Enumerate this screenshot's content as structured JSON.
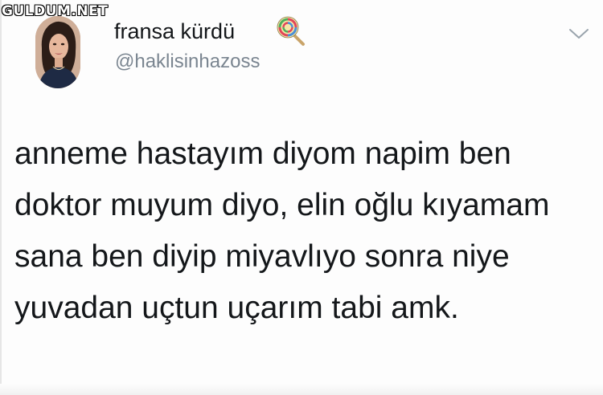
{
  "watermark": {
    "text": "GULDUM.NET"
  },
  "tweet": {
    "author": {
      "display_name": "fransa kürdü",
      "handle": "@haklisinhazoss",
      "name_emoji_icon": "lollipop-icon",
      "avatar_icon": "avatar-photo"
    },
    "menu_icon": "chevron-down-icon",
    "text_lines": [
      "anneme hastayım diyom napim ben",
      "doktor muyum diyo, elin oğlu kıyamam",
      "sana ben diyip miyavlıyo sonra niye",
      "yuvadan uçtun uçarım tabi amk."
    ]
  },
  "colors": {
    "text": "#14171a",
    "handle": "#7a8590",
    "background": "#fdfdfd"
  }
}
